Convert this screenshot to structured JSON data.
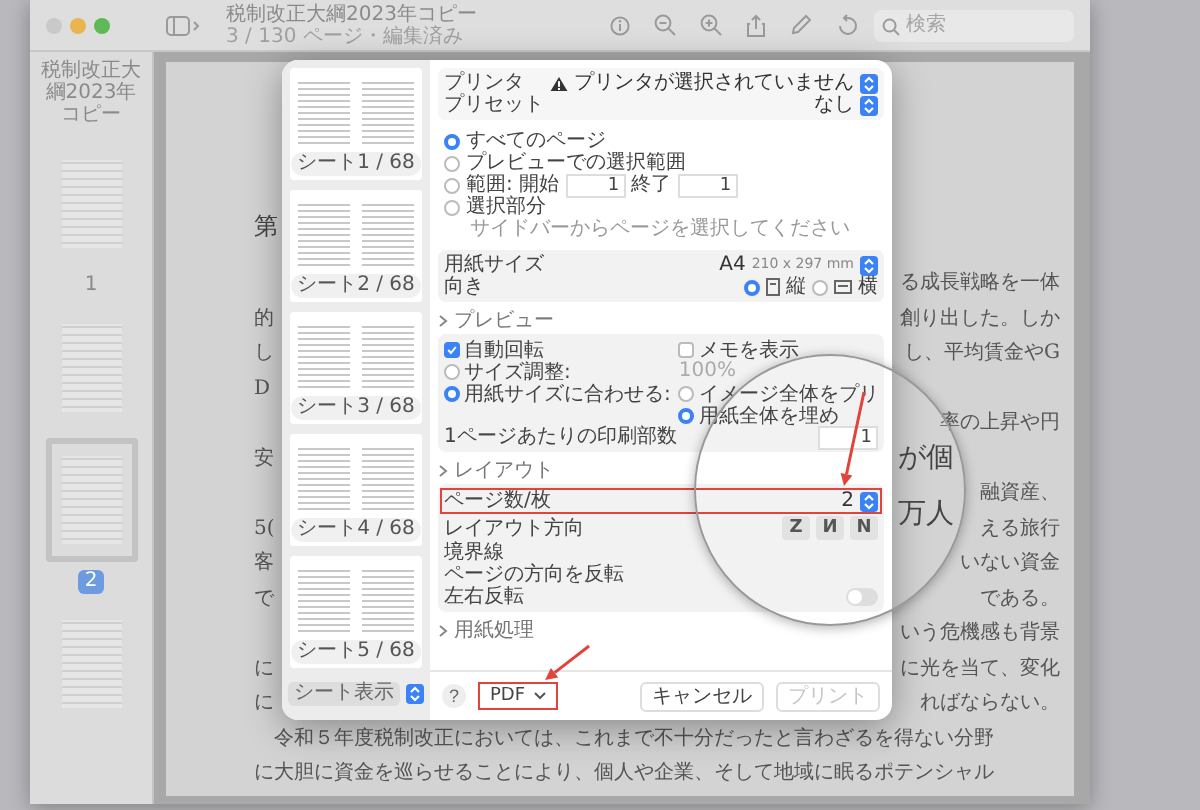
{
  "window": {
    "title": "税制改正大綱2023年コピー",
    "subtitle": "3 / 130 ページ・編集済み",
    "search_placeholder": "検索"
  },
  "sidebar": {
    "title": "税制改正大綱2023年コピー",
    "pages": [
      {
        "label": "1",
        "selected": false
      },
      {
        "selected": false
      },
      {
        "label": "2",
        "selected": true
      },
      {
        "selected": false
      }
    ]
  },
  "document": {
    "heading": "第",
    "lines": [
      {
        "kind": "split",
        "right": "る成長戦略を一体"
      },
      {
        "kind": "split",
        "left": "的",
        "right": "創り出した。しか"
      },
      {
        "kind": "split",
        "left": "し",
        "right": "し、平均賃金やG"
      },
      {
        "kind": "split",
        "left": "D"
      },
      {
        "kind": "split",
        "right": "率の上昇や円"
      },
      {
        "kind": "split",
        "left": "安"
      },
      {
        "kind": "split",
        "right": "融資産、"
      },
      {
        "kind": "split",
        "left": "5(",
        "right": "える旅行"
      },
      {
        "kind": "split",
        "left": "客",
        "right": "いない資金"
      },
      {
        "kind": "split",
        "left": "で",
        "right": "である。"
      },
      {
        "kind": "split",
        "right": "いう危機感も背景"
      },
      {
        "kind": "split",
        "left": "に",
        "right": "に光を当て、変化"
      },
      {
        "kind": "split",
        "left": "に",
        "right": "ればならない。"
      },
      {
        "kind": "indented",
        "text": "令和５年度税制改正においては、これまで不十分だったと言わざるを得ない分野"
      },
      {
        "kind": "full",
        "text": "に大胆に資金を巡らせることにより、個人や企業、そして地域に眠るポテンシャル"
      }
    ]
  },
  "print_dialog": {
    "sheets": [
      {
        "label": "シート1 / 68"
      },
      {
        "label": "シート2 / 68"
      },
      {
        "label": "シート3 / 68"
      },
      {
        "label": "シート4 / 68"
      },
      {
        "label": "シート5 / 68"
      }
    ],
    "sheet_menu": "シート表示",
    "printer": {
      "label": "プリンタ",
      "value": "プリンタが選択されていません"
    },
    "preset": {
      "label": "プリセット",
      "value": "なし"
    },
    "page_options": [
      {
        "kind": "plain",
        "label": "すべてのページ",
        "selected": true
      },
      {
        "kind": "plain",
        "label": "プレビューでの選択範囲",
        "selected": false
      },
      {
        "kind": "range",
        "label": "範囲: 開始",
        "selected": false,
        "from": "1",
        "to_label": "終了",
        "to": "1"
      },
      {
        "kind": "hint",
        "label": "選択部分",
        "selected": false,
        "hint": "サイドバーからページを選択してください"
      }
    ],
    "paper_size": {
      "label": "用紙サイズ",
      "value": "A4",
      "detail": "210 x 297 mm"
    },
    "orientation": {
      "label": "向き",
      "options": [
        {
          "kind": "portrait",
          "label": "縦",
          "selected": true
        },
        {
          "kind": "landscape",
          "label": "横",
          "selected": false
        }
      ]
    },
    "preview_section": {
      "title": "プレビュー",
      "auto_rotate": {
        "label": "自動回転",
        "checked": true
      },
      "show_notes": {
        "label": "メモを表示",
        "checked": false
      },
      "scale": {
        "label": "サイズ調整:",
        "selected": false,
        "value": "100%"
      },
      "fit": {
        "label": "用紙サイズに合わせる:",
        "selected": true
      },
      "fit_options": [
        {
          "label": "イメージ全体をプリ",
          "selected": false
        },
        {
          "label": "用紙全体を埋め",
          "selected": true
        }
      ],
      "copies_per_page": {
        "label": "1ページあたりの印刷部数",
        "value": "1"
      }
    },
    "layout_section": {
      "title": "レイアウト",
      "pages_per_sheet": {
        "label": "ページ数/枚",
        "value": "2",
        "highlighted": true
      },
      "direction": {
        "label": "レイアウト方向",
        "options": [
          "Z",
          "И",
          "N"
        ]
      },
      "border": {
        "label": "境界線"
      },
      "flip": {
        "label": "ページの方向を反転"
      },
      "mirror": {
        "label": "左右反転",
        "on": false
      }
    },
    "next_section": "用紙処理",
    "footer": {
      "help": "?",
      "pdf": {
        "label": "PDF",
        "highlighted": true
      },
      "cancel": "キャンセル",
      "print": {
        "label": "プリント",
        "disabled": true
      }
    }
  },
  "magnifier": {
    "texts": [
      "が個",
      "万人"
    ]
  }
}
